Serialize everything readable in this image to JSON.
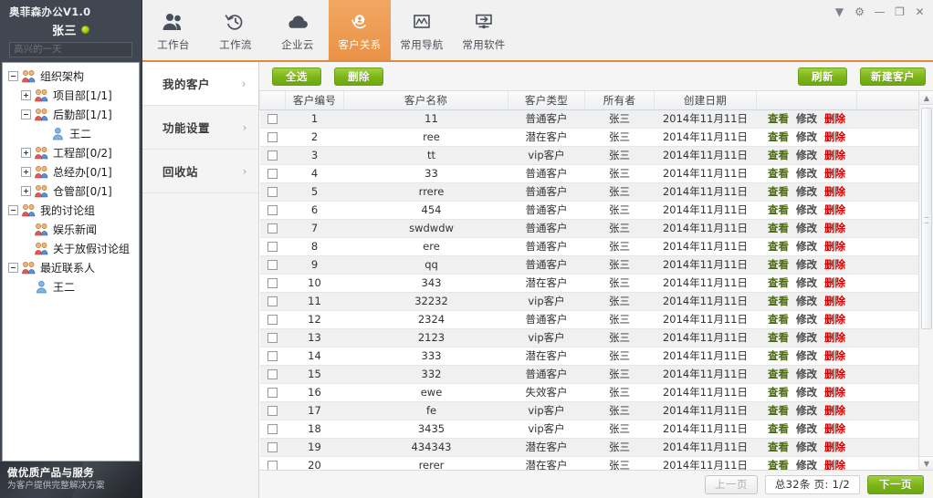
{
  "window": {
    "app_title": "奥菲森办公V1.0",
    "controls": [
      {
        "name": "collapse-icon",
        "glyph": "▼"
      },
      {
        "name": "settings-gear-icon",
        "glyph": "⚙"
      },
      {
        "name": "minimize-icon",
        "glyph": "—"
      },
      {
        "name": "maximize-icon",
        "glyph": "❐"
      },
      {
        "name": "close-icon",
        "glyph": "✕"
      }
    ]
  },
  "user": {
    "name": "张三",
    "online_status": "online",
    "signature": "高兴的一天",
    "signature_placeholder": "高兴的一天"
  },
  "tree": [
    {
      "label": "组织架构",
      "indent": 0,
      "expander": "minus",
      "icon": "group-icon"
    },
    {
      "label": "项目部[1/1]",
      "indent": 1,
      "expander": "plus",
      "icon": "group-icon"
    },
    {
      "label": "后勤部[1/1]",
      "indent": 1,
      "expander": "minus",
      "icon": "group-icon"
    },
    {
      "label": "王二",
      "indent": 2,
      "expander": "none",
      "icon": "user-icon"
    },
    {
      "label": "工程部[0/2]",
      "indent": 1,
      "expander": "plus",
      "icon": "group-icon"
    },
    {
      "label": "总经办[0/1]",
      "indent": 1,
      "expander": "plus",
      "icon": "group-icon"
    },
    {
      "label": "仓管部[0/1]",
      "indent": 1,
      "expander": "plus",
      "icon": "group-icon"
    },
    {
      "label": "我的讨论组",
      "indent": 0,
      "expander": "minus",
      "icon": "group-icon"
    },
    {
      "label": "娱乐新闻",
      "indent": 1,
      "expander": "none",
      "icon": "group-icon"
    },
    {
      "label": "关于放假讨论组",
      "indent": 1,
      "expander": "none",
      "icon": "group-icon"
    },
    {
      "label": "最近联系人",
      "indent": 0,
      "expander": "minus",
      "icon": "group-icon"
    },
    {
      "label": "王二",
      "indent": 1,
      "expander": "none",
      "icon": "user-icon"
    }
  ],
  "brand": {
    "title": "做优质产品与服务",
    "subtitle": "为客户提供完整解决方案"
  },
  "toolbar": {
    "items": [
      {
        "label": "工作台",
        "icon": "people-icon",
        "active": false
      },
      {
        "label": "工作流",
        "icon": "clock-back-icon",
        "active": false
      },
      {
        "label": "企业云",
        "icon": "cloud-icon",
        "active": false
      },
      {
        "label": "客户关系",
        "icon": "contact-ring-icon",
        "active": true
      },
      {
        "label": "常用导航",
        "icon": "chart-frame-icon",
        "active": false
      },
      {
        "label": "常用软件",
        "icon": "monitor-icon",
        "active": false
      }
    ]
  },
  "nav": {
    "items": [
      {
        "label": "我的客户",
        "active": true,
        "chevron": "›"
      },
      {
        "label": "功能设置",
        "active": false,
        "chevron": "›"
      },
      {
        "label": "回收站",
        "active": false,
        "chevron": "›"
      }
    ]
  },
  "actions": {
    "select_all": "全选",
    "delete": "删除",
    "refresh": "刷新",
    "new_customer": "新建客户"
  },
  "table": {
    "columns": [
      "",
      "客户编号",
      "客户名称",
      "客户类型",
      "所有者",
      "创建日期",
      "",
      ""
    ],
    "row_actions": {
      "view": "查看",
      "edit": "修改",
      "delete": "删除"
    },
    "rows": [
      {
        "no": "1",
        "name": "11",
        "type": "普通客户",
        "owner": "张三",
        "date": "2014年11月11日"
      },
      {
        "no": "2",
        "name": "ree",
        "type": "潜在客户",
        "owner": "张三",
        "date": "2014年11月11日"
      },
      {
        "no": "3",
        "name": "tt",
        "type": "vip客户",
        "owner": "张三",
        "date": "2014年11月11日"
      },
      {
        "no": "4",
        "name": "33",
        "type": "普通客户",
        "owner": "张三",
        "date": "2014年11月11日"
      },
      {
        "no": "5",
        "name": "rrere",
        "type": "普通客户",
        "owner": "张三",
        "date": "2014年11月11日"
      },
      {
        "no": "6",
        "name": "454",
        "type": "普通客户",
        "owner": "张三",
        "date": "2014年11月11日"
      },
      {
        "no": "7",
        "name": "swdwdw",
        "type": "普通客户",
        "owner": "张三",
        "date": "2014年11月11日"
      },
      {
        "no": "8",
        "name": "ere",
        "type": "普通客户",
        "owner": "张三",
        "date": "2014年11月11日"
      },
      {
        "no": "9",
        "name": "qq",
        "type": "普通客户",
        "owner": "张三",
        "date": "2014年11月11日"
      },
      {
        "no": "10",
        "name": "343",
        "type": "潜在客户",
        "owner": "张三",
        "date": "2014年11月11日"
      },
      {
        "no": "11",
        "name": "32232",
        "type": "vip客户",
        "owner": "张三",
        "date": "2014年11月11日"
      },
      {
        "no": "12",
        "name": "2324",
        "type": "普通客户",
        "owner": "张三",
        "date": "2014年11月11日"
      },
      {
        "no": "13",
        "name": "2123",
        "type": "vip客户",
        "owner": "张三",
        "date": "2014年11月11日"
      },
      {
        "no": "14",
        "name": "333",
        "type": "潜在客户",
        "owner": "张三",
        "date": "2014年11月11日"
      },
      {
        "no": "15",
        "name": "332",
        "type": "普通客户",
        "owner": "张三",
        "date": "2014年11月11日"
      },
      {
        "no": "16",
        "name": "ewe",
        "type": "失效客户",
        "owner": "张三",
        "date": "2014年11月11日"
      },
      {
        "no": "17",
        "name": "fe",
        "type": "vip客户",
        "owner": "张三",
        "date": "2014年11月11日"
      },
      {
        "no": "18",
        "name": "3435",
        "type": "vip客户",
        "owner": "张三",
        "date": "2014年11月11日"
      },
      {
        "no": "19",
        "name": "434343",
        "type": "潜在客户",
        "owner": "张三",
        "date": "2014年11月11日"
      },
      {
        "no": "20",
        "name": "rerer",
        "type": "潜在客户",
        "owner": "张三",
        "date": "2014年11月11日"
      }
    ]
  },
  "pager": {
    "prev": "上一页",
    "info": "总32条 页: 1/2",
    "next": "下一页"
  },
  "colors": {
    "accent_orange": "#ea9247",
    "green_button": "#7cb518",
    "delete_red": "#d40000",
    "panel_dark": "#414751"
  }
}
